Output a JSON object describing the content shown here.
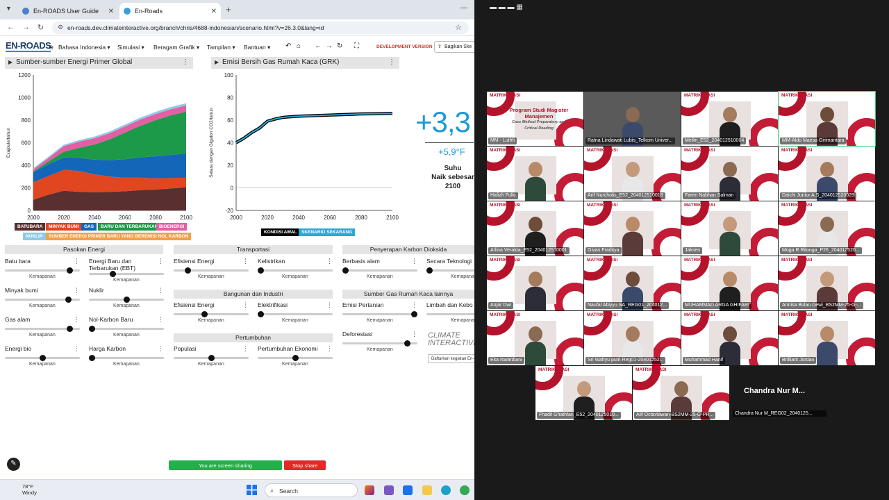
{
  "browser": {
    "tabs": [
      {
        "label": "En-ROADS User Guide",
        "active": false
      },
      {
        "label": "En-Roads",
        "active": true
      }
    ],
    "url": "en-roads.dev.climateinteractive.org/branch/chris/4688-indonesian/scenario.html?v=26.3.0&lang=id"
  },
  "app": {
    "logo": "EN-ROADS",
    "menus": [
      "Bahasa Indonesia",
      "Simulasi",
      "Beragam Grafik",
      "Tampilan",
      "Bantuan"
    ],
    "dev_version": "DEVELOPMENT VERSION",
    "share_label": "Bagikan Ske"
  },
  "panels": {
    "left_title": "Sumber-sumber Energi Primer Global",
    "right_title": "Emisi Bersih Gas Rumah Kaca (GRK)"
  },
  "chart_data": [
    {
      "type": "area",
      "title": "Sumber-sumber Energi Primer Global",
      "ylabel": "Exajoule/tahun",
      "xlabel": "",
      "x": [
        2000,
        2010,
        2020,
        2030,
        2040,
        2050,
        2060,
        2070,
        2080,
        2090,
        2100
      ],
      "xticks": [
        2000,
        2020,
        2040,
        2060,
        2080,
        2100
      ],
      "yticks": [
        0,
        200,
        400,
        600,
        800,
        1000,
        1200
      ],
      "ylim": [
        0,
        1200
      ],
      "xlim": [
        2000,
        2100
      ],
      "series": [
        {
          "name": "BATUBARA",
          "color": "#5a2f2f",
          "values": [
            95,
            140,
            175,
            165,
            160,
            165,
            170,
            180,
            185,
            195,
            205
          ]
        },
        {
          "name": "MINYAK BUMI",
          "color": "#e0461f",
          "values": [
            155,
            165,
            185,
            185,
            160,
            135,
            120,
            110,
            100,
            92,
            85
          ]
        },
        {
          "name": "GAS",
          "color": "#1466b8",
          "values": [
            90,
            105,
            110,
            115,
            130,
            145,
            165,
            180,
            195,
            205,
            215
          ]
        },
        {
          "name": "BARU DAN TERBARUKAN",
          "color": "#1d9a49",
          "values": [
            5,
            25,
            50,
            90,
            135,
            185,
            235,
            280,
            320,
            350,
            370
          ]
        },
        {
          "name": "BIOENERGI",
          "color": "#e25fa3",
          "values": [
            20,
            30,
            50,
            55,
            55,
            55,
            55,
            55,
            55,
            55,
            55
          ]
        },
        {
          "name": "NUKLIR",
          "color": "#8ecae6",
          "values": [
            10,
            12,
            12,
            13,
            14,
            15,
            16,
            17,
            18,
            19,
            20
          ]
        },
        {
          "name": "SUMBER ENERGI PRIMER BARU YANG BEREMISI NOL KARBON",
          "color": "#f0a04b",
          "values": [
            0,
            0,
            0,
            0,
            0,
            0,
            0,
            0,
            0,
            0,
            0
          ]
        }
      ]
    },
    {
      "type": "line",
      "title": "Emisi Bersih Gas Rumah Kaca (GRK)",
      "ylabel": "Setara dengan Gigaton CO2/tahun",
      "xlabel": "",
      "x": [
        2000,
        2005,
        2010,
        2015,
        2020,
        2025,
        2030,
        2040,
        2050,
        2060,
        2070,
        2080,
        2090,
        2100
      ],
      "xticks": [
        2000,
        2020,
        2040,
        2060,
        2080,
        2100
      ],
      "yticks": [
        -20,
        0,
        20,
        40,
        60,
        80,
        100
      ],
      "ylim": [
        -20,
        100
      ],
      "xlim": [
        2000,
        2100
      ],
      "series": [
        {
          "name": "KONDISI AWAL",
          "color": "#000000",
          "values": [
            40,
            44,
            49,
            53,
            59,
            61,
            62.5,
            63.5,
            64,
            64.5,
            65,
            65.5,
            65.7,
            66
          ]
        },
        {
          "name": "SKENARIO SEKARANG",
          "color": "#2aa8d6",
          "values": [
            40,
            44,
            49,
            53,
            59,
            61,
            62.5,
            63.5,
            64,
            64.5,
            65,
            65.5,
            65.7,
            66
          ]
        }
      ]
    }
  ],
  "temperature": {
    "celsius": "+3,3",
    "fahrenheit": "+5,9°F",
    "label1": "Suhu",
    "label2": "Naik sebesar",
    "label3": "2100"
  },
  "sections": [
    {
      "title": "Pasokan Energi",
      "controls": [
        {
          "label": "Batu bara",
          "value": 0.9
        },
        {
          "label": "Energi Baru dan Terbarukan (EBT)",
          "value": 0.3
        },
        {
          "label": "Minyak bumi",
          "value": 0.88
        },
        {
          "label": "Nuklir",
          "value": 0.5
        },
        {
          "label": "Gas alam",
          "value": 0.9
        },
        {
          "label": "Nol-Karbon Baru",
          "value": 0.0
        },
        {
          "label": "Energi bio",
          "value": 0.5
        },
        {
          "label": "Harga Karbon",
          "value": 0.0
        }
      ]
    },
    {
      "title": "Transportasi",
      "controls": [
        {
          "label": "Efisiensi Energi",
          "value": 0.16
        },
        {
          "label": "Kelistrikan",
          "value": 0.0
        }
      ]
    },
    {
      "title": "Bangunan dan Industri",
      "controls": [
        {
          "label": "Efisiensi Energi",
          "value": 0.4
        },
        {
          "label": "Elektrifikasi",
          "value": 0.0
        }
      ]
    },
    {
      "title": "Pertumbuhan",
      "controls": [
        {
          "label": "Populasi",
          "value": 0.5
        },
        {
          "label": "Pertumbuhan Ekonomi",
          "value": 0.5
        }
      ]
    },
    {
      "title": "Penyerapan Karbon Dioksida",
      "controls": [
        {
          "label": "Berbasis alam",
          "value": 0.0
        },
        {
          "label": "Secara Teknologi",
          "value": 0.0
        }
      ]
    },
    {
      "title": "Sumber Gas Rumah Kaca lainnya",
      "controls": [
        {
          "label": "Emisi Pertanian",
          "value": 1.0
        },
        {
          "label": "Limbah dan Kebo",
          "value": 1.0
        },
        {
          "label": "Deforestasi",
          "value": 0.9
        }
      ]
    }
  ],
  "status_word": "Kemapanan",
  "climate_interactive": "CLIMATE INTERACTIVE",
  "daftarkan": "Daftarkan kegiatan En-",
  "screen_share": {
    "label": "You are screen sharing",
    "stop": "Stop share"
  },
  "taskbar": {
    "temp": "78°F",
    "weather": "Windy",
    "search": "Search"
  },
  "meeting": {
    "participants": [
      "MM - Luthfi",
      "Ratna Lindawati Lubis_Telkom Univer...",
      "Meilin_E52_204012510004",
      "MM-Aldo Maesa Girimantara",
      "Hafizh Fulki",
      "Arif Nurcholis_E52_204012510018",
      "Faren Nabhan Salman",
      "Daichi Junior A.S_204012520029",
      "Arlina Veralda_E52_204012510001",
      "Givan Fraditya",
      "Jaksen",
      "Moga R Ritonga_P26_204012520...",
      "Anjar Dwi",
      "Naufal Abiyyu SA_REG01_204012...",
      "MUHAMMAD ARGA GHIFARI",
      "Annisa Bulan Dewi_BS2MM-25-G-...",
      "Eka Iswardiani",
      "Sri Wahyu putri Reg01-20401252...",
      "Muhammad Hanif",
      "Brilliant Jordan",
      "Fhadil Ghathfan_E52_2040125010...",
      "Alif Octaviawan-BS2MM-25-G-PR..."
    ],
    "tile_title": "MATRIKULASI",
    "highlight_tile_text": [
      "Program Studi Magister Manajemen",
      "Case Method Preparatory and Critical Reading"
    ],
    "big_name": "Chandra Nur M...",
    "small_name": "Chandra Nur M_REG02_2040125..."
  }
}
